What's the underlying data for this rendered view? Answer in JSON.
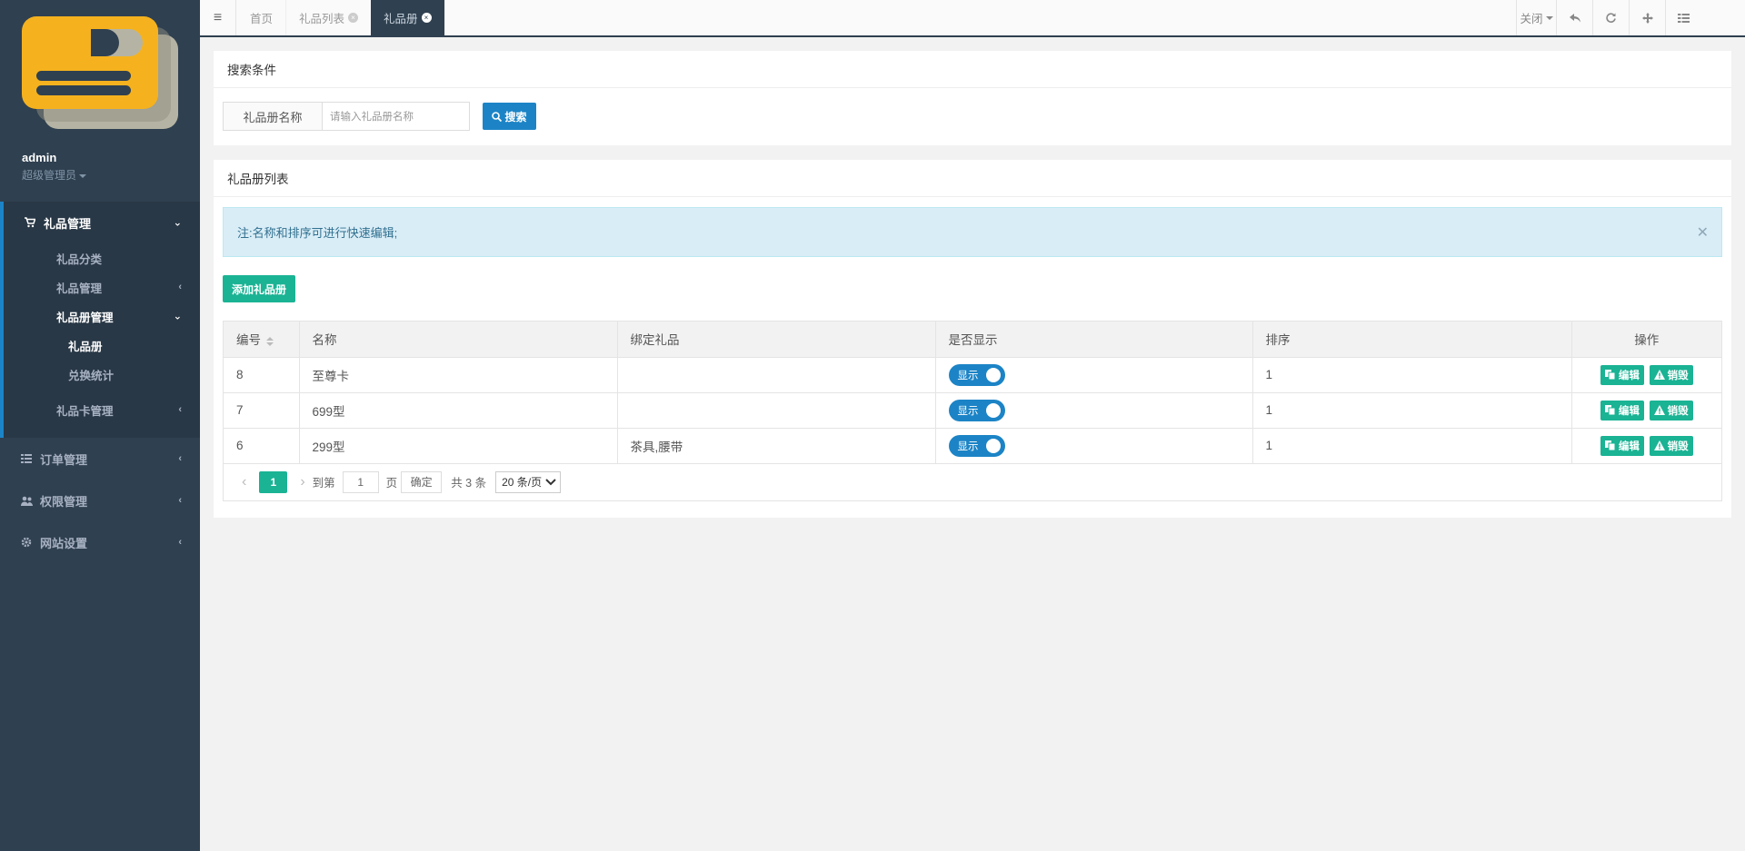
{
  "sidebar": {
    "user_name": "admin",
    "user_role": "超级管理员",
    "menu": {
      "gift_mgmt": "礼品管理",
      "gift_category": "礼品分类",
      "gift_mgmt_sub": "礼品管理",
      "giftbook_mgmt": "礼品册管理",
      "giftbook": "礼品册",
      "exchange_stats": "兑换统计",
      "giftcard_mgmt": "礼品卡管理",
      "order_mgmt": "订单管理",
      "permission_mgmt": "权限管理",
      "site_settings": "网站设置"
    }
  },
  "topbar": {
    "tabs": [
      "首页",
      "礼品列表",
      "礼品册"
    ],
    "close_label": "关闭"
  },
  "search": {
    "title": "搜索条件",
    "field_label": "礼品册名称",
    "placeholder": "请输入礼品册名称",
    "button": "搜索"
  },
  "list": {
    "title": "礼品册列表",
    "notice": "注:名称和排序可进行快速编辑;",
    "add_button": "添加礼品册",
    "columns": [
      "编号",
      "名称",
      "绑定礼品",
      "是否显示",
      "排序",
      "操作"
    ],
    "rows": [
      {
        "id": "8",
        "name": "至尊卡",
        "gifts": "",
        "show": "显示",
        "sort": "1"
      },
      {
        "id": "7",
        "name": "699型",
        "gifts": "",
        "show": "显示",
        "sort": "1"
      },
      {
        "id": "6",
        "name": "299型",
        "gifts": "茶具,腰带",
        "show": "显示",
        "sort": "1"
      }
    ],
    "edit_label": "编辑",
    "delete_label": "销毁"
  },
  "pager": {
    "current": "1",
    "goto_label": "到第",
    "page_input": "1",
    "page_unit": "页",
    "ok": "确定",
    "total": "共 3 条",
    "per_page": "20 条/页"
  },
  "colors": {
    "sidebar_bg": "#2f4050",
    "primary_blue": "#1c84c6",
    "primary_green": "#1ab394",
    "alert_bg": "#d9edf7"
  }
}
